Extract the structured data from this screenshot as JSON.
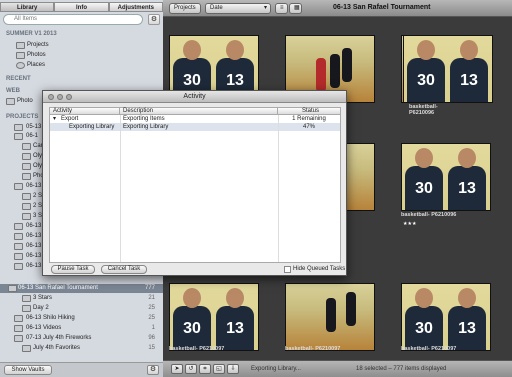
{
  "library_tabs": [
    "Library",
    "Info",
    "Adjustments"
  ],
  "search": {
    "placeholder": "All Items"
  },
  "sidebar": {
    "section_summer": "SUMMER V1 2013",
    "top_items": [
      {
        "label": "Projects"
      },
      {
        "label": "Photos"
      },
      {
        "label": "Places"
      }
    ],
    "section_recent": "RECENT",
    "section_web": "WEB",
    "web_item": "Photo",
    "section_projects": "PROJECTS",
    "project_items": [
      {
        "label": "05-13",
        "count": ""
      },
      {
        "label": "06-1",
        "count": ""
      },
      {
        "label": "Can",
        "count": ""
      },
      {
        "label": "Oly",
        "count": ""
      },
      {
        "label": "Oly",
        "count": ""
      },
      {
        "label": "Pho",
        "count": ""
      },
      {
        "label": "06-13",
        "count": ""
      },
      {
        "label": "2 St",
        "count": ""
      },
      {
        "label": "2 St",
        "count": ""
      },
      {
        "label": "3 St",
        "count": ""
      },
      {
        "label": "06-13",
        "count": ""
      },
      {
        "label": "06-13",
        "count": ""
      },
      {
        "label": "06-13",
        "count": ""
      },
      {
        "label": "06-13",
        "count": ""
      },
      {
        "label": "06-13",
        "count": ""
      },
      {
        "label": "06-13 San Rafael Tournament",
        "count": "777"
      },
      {
        "label": "3 Stars",
        "count": "21"
      },
      {
        "label": "Day 2",
        "count": "25"
      },
      {
        "label": "06-13 Shilo Hiking",
        "count": "25"
      },
      {
        "label": "06-13 Videos",
        "count": "1"
      },
      {
        "label": "07-13 July 4th Fireworks",
        "count": "96"
      },
      {
        "label": "July 4th Favorites",
        "count": "15"
      }
    ],
    "show_vaults": "Show Vaults"
  },
  "toolbar": {
    "projects_label": "Projects",
    "sort_label": "Date",
    "title": "06-13 San Rafael Tournament"
  },
  "photos": {
    "captions": [
      "basketball- P6210096",
      "basketball- P6210097"
    ]
  },
  "status": {
    "exporting": "Exporting Library...",
    "selection": "18 selected – 777 items displayed"
  },
  "dialog": {
    "title": "Activity",
    "columns": [
      "Activity",
      "Description",
      "Status"
    ],
    "rows": [
      {
        "activity": "Export",
        "description": "Exporting Items",
        "status": "1 Remaining"
      },
      {
        "activity": "Exporting Library",
        "description": "Exporting Library",
        "status": "47%"
      }
    ],
    "pause_label": "Pause Task",
    "cancel_label": "Cancel Task",
    "hide_label": "Hide Queued Tasks"
  },
  "colors": {
    "selection": "#7b8694",
    "accent": "#dde3ec"
  }
}
